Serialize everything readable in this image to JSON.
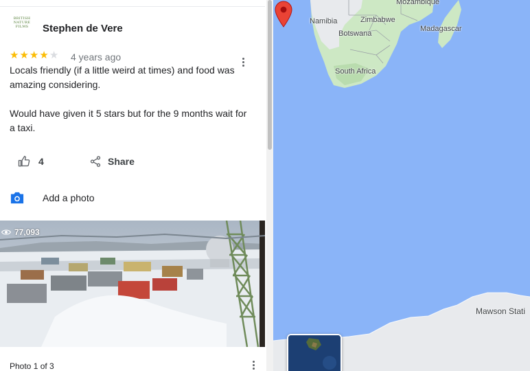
{
  "review": {
    "author": "Stephen de Vere",
    "avatar_text": [
      "BRITISH",
      "NATURE",
      "FILMS"
    ],
    "rating": 4,
    "rating_max": 5,
    "timestamp": "4 years ago",
    "paragraphs": [
      "Locals friendly (if a little weird at times) and food was amazing considering.",
      "Would have given it 5 stars but for the 9 months wait for a taxi."
    ],
    "like_count": "4",
    "share_label": "Share",
    "like_icon": "thumb-up-icon",
    "share_icon": "share-icon",
    "more_icon": "more-vert-icon"
  },
  "add_photo": {
    "label": "Add a photo",
    "icon": "camera-icon"
  },
  "photo": {
    "views": "77,093",
    "views_icon": "eye-icon",
    "caption": "Photo 1 of 3"
  },
  "map": {
    "labels": {
      "mozambique": "Mozambique",
      "namibia": "Namibia",
      "zimbabwe": "Zimbabwe",
      "botswana": "Botswana",
      "madagascar": "Madagascar",
      "south_africa": "South Africa"
    },
    "station": "Mawson Stati",
    "pin_icon": "location-pin-icon",
    "colors": {
      "ocean": "#8ab4f8",
      "land": "#e8eaed",
      "vegetation": "#cde8c4",
      "pin": "#ea4335"
    }
  },
  "colors": {
    "accent": "#1a73e8",
    "star": "#fbbc04"
  }
}
